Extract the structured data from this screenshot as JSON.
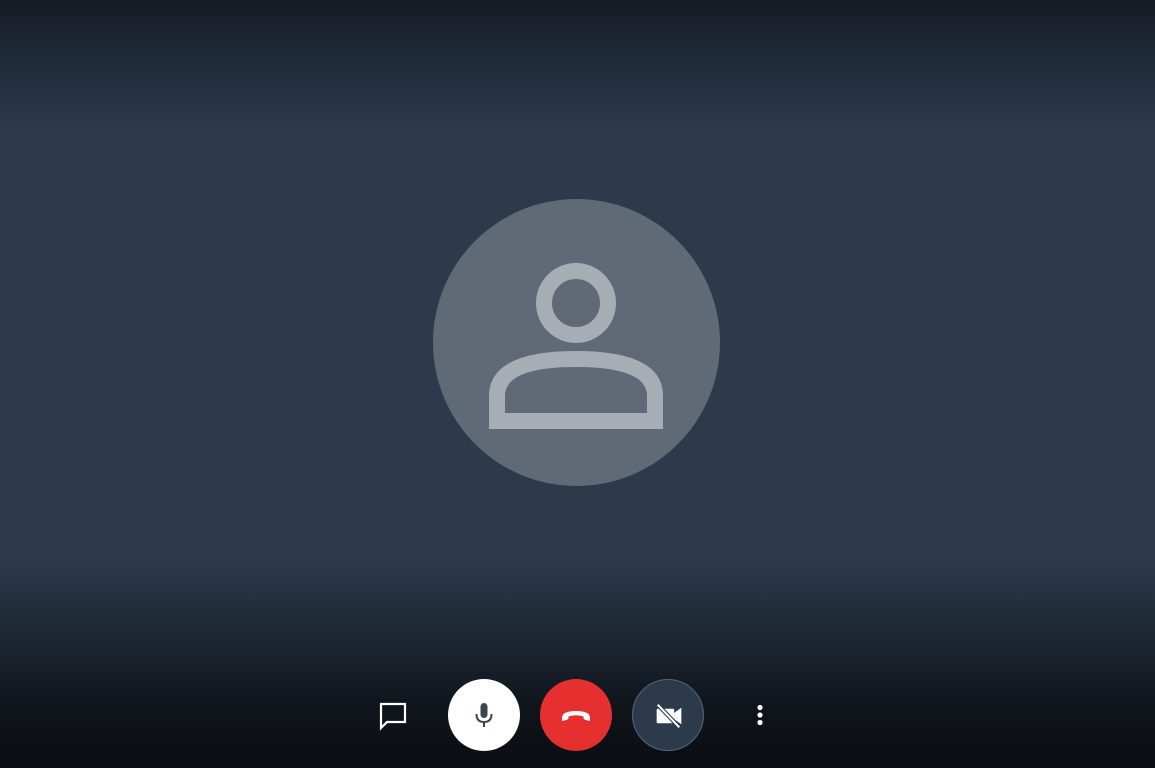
{
  "call": {
    "participant_avatar_icon": "person-icon",
    "avatar_color": "#5f6a76",
    "background_color": "#2c3a4c"
  },
  "controls": {
    "chat": {
      "icon": "chat-bubble-icon"
    },
    "microphone": {
      "icon": "microphone-icon",
      "state": "on",
      "color": "#ffffff"
    },
    "end_call": {
      "icon": "hang-up-icon",
      "color": "#e5302f"
    },
    "camera": {
      "icon": "video-off-icon",
      "state": "off",
      "color": "#2c3a4c"
    },
    "more": {
      "icon": "more-vertical-icon"
    }
  }
}
